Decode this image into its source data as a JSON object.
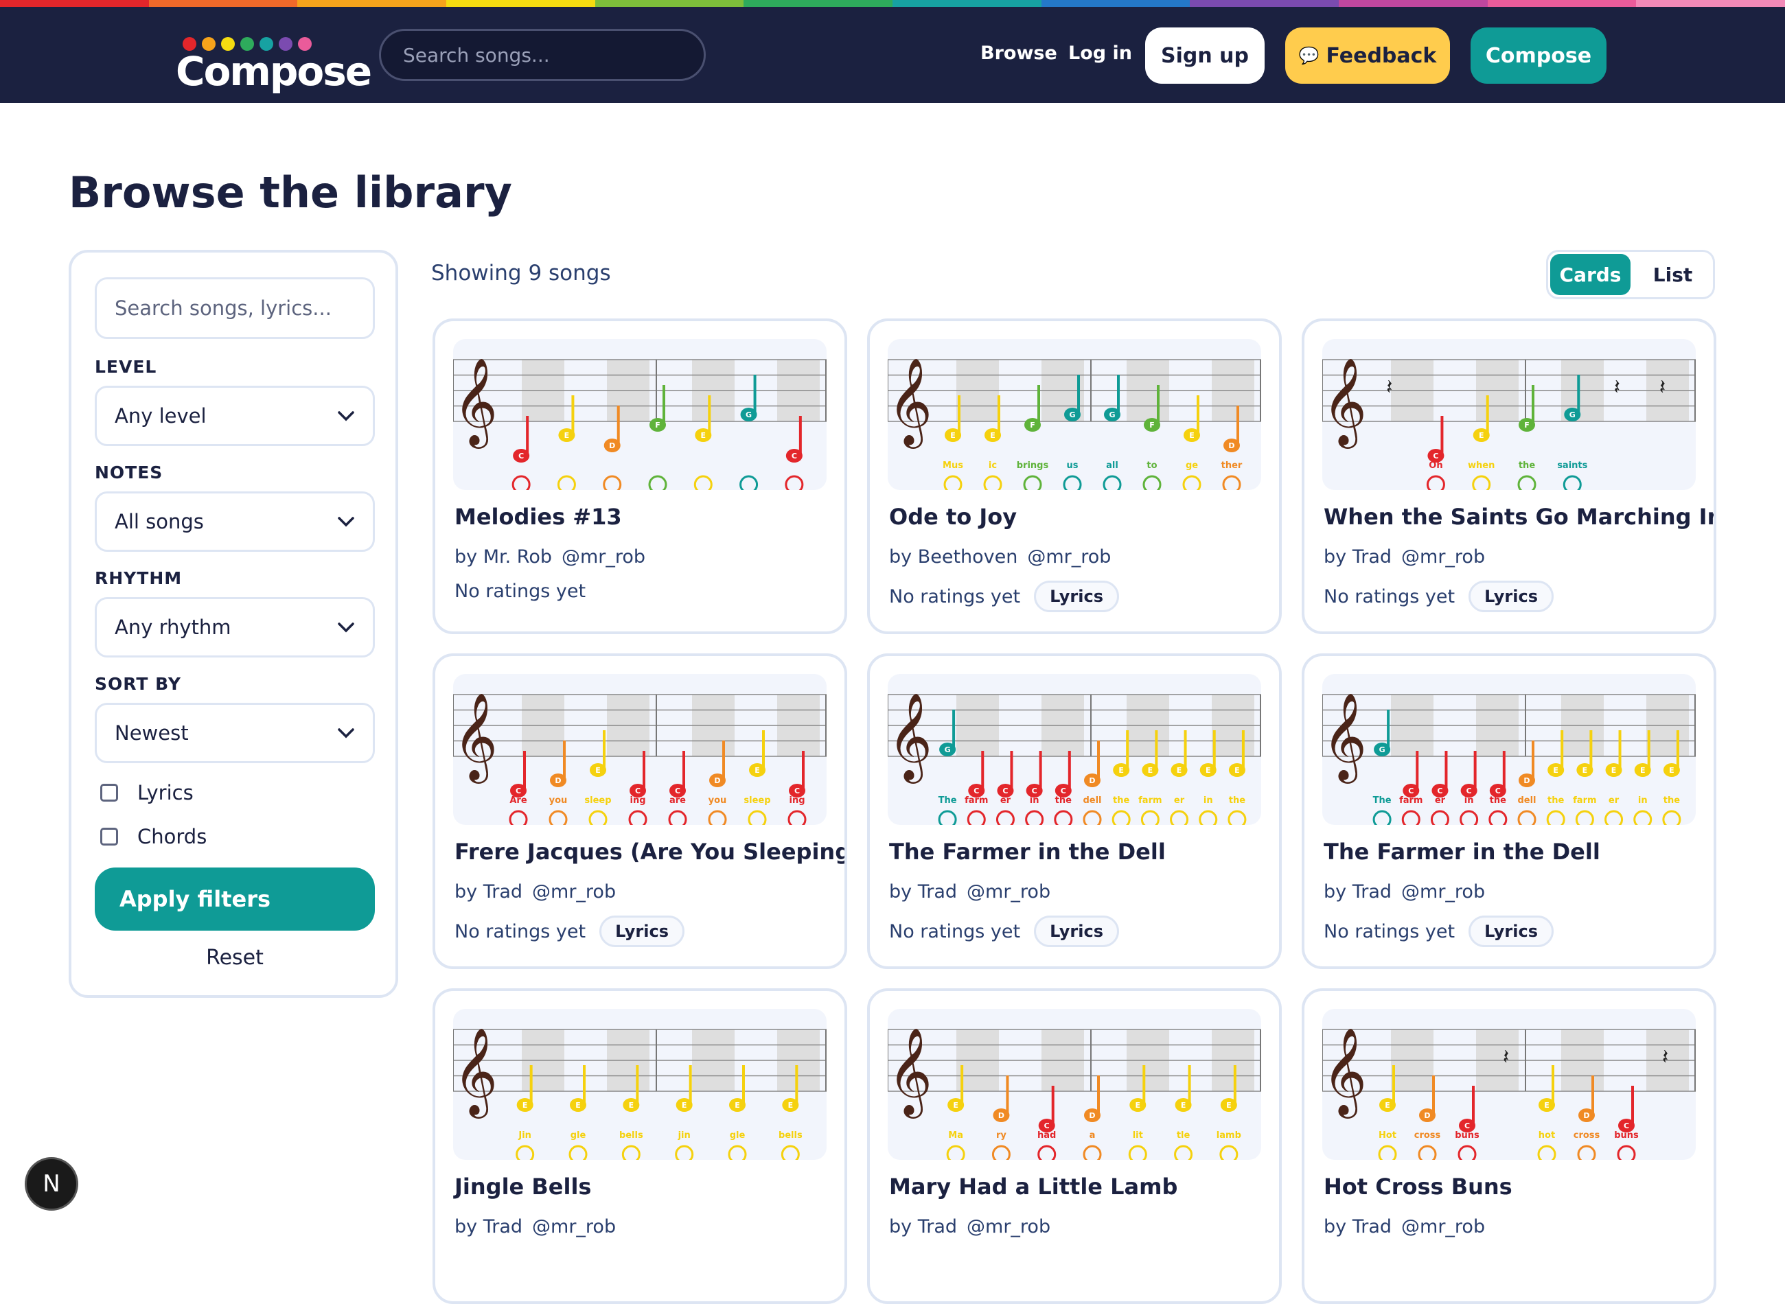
{
  "rainbow": [
    "#e3262b",
    "#f0692a",
    "#f6a31b",
    "#f5dc11",
    "#7dbf3a",
    "#2eab5c",
    "#17a2a2",
    "#2478c8",
    "#7b4bb0",
    "#c0479f",
    "#ea5b9a",
    "#f28ab8"
  ],
  "header": {
    "logo_text": "Compose",
    "search_placeholder": "Search songs...",
    "nav": {
      "browse": "Browse",
      "login": "Log in"
    },
    "signup_label": "Sign up",
    "feedback_label": "Feedback",
    "compose_label": "Compose"
  },
  "page": {
    "title": "Browse the library"
  },
  "sidebar": {
    "search_placeholder": "Search songs, lyrics...",
    "level_label": "LEVEL",
    "level_value": "Any level",
    "notes_label": "NOTES",
    "notes_value": "All songs",
    "rhythm_label": "RHYTHM",
    "rhythm_value": "Any rhythm",
    "sort_label": "SORT BY",
    "sort_value": "Newest",
    "lyrics_label": "Lyrics",
    "chords_label": "Chords",
    "apply_label": "Apply filters",
    "reset_label": "Reset"
  },
  "results": {
    "showing": "Showing 9 songs",
    "view_cards": "Cards",
    "view_list": "List"
  },
  "colors": {
    "C": "#e3262b",
    "D": "#f08a24",
    "E": "#f5d10e",
    "F": "#5fb33a",
    "G": "#0f9b96",
    "A": "#2f6fc0",
    "B": "#8c4bb0",
    "accent": "#0f9b96",
    "navy": "#1b2140",
    "feedback": "#ffcc4d"
  },
  "songs": [
    {
      "title": "Melodies #13",
      "composer": "by Mr. Rob",
      "user": "@mr_rob",
      "rating": "No ratings yet",
      "badge": "",
      "notes": [
        "C",
        "E",
        "D",
        "F",
        "E",
        "G",
        "C"
      ],
      "rests": [
        7
      ],
      "lyrics": []
    },
    {
      "title": "Ode to Joy",
      "composer": "by Beethoven",
      "user": "@mr_rob",
      "rating": "No ratings yet",
      "badge": "Lyrics",
      "notes": [
        "E",
        "E",
        "F",
        "G",
        "G",
        "F",
        "E",
        "D"
      ],
      "rests": [],
      "lyrics": [
        "Mus",
        "ic",
        "brings",
        "us",
        "all",
        "to",
        "ge",
        "ther"
      ]
    },
    {
      "title": "When the Saints Go Marching In",
      "composer": "by Trad",
      "user": "@mr_rob",
      "rating": "No ratings yet",
      "badge": "Lyrics",
      "notes": [
        "-",
        "C",
        "E",
        "F",
        "G",
        "-",
        "-"
      ],
      "rests": [
        0,
        5,
        6
      ],
      "lyrics": [
        "",
        "Oh",
        "when",
        "the",
        "saints",
        "",
        ""
      ]
    },
    {
      "title": "Frere Jacques (Are You Sleeping?)",
      "composer": "by Trad",
      "user": "@mr_rob",
      "rating": "No ratings yet",
      "badge": "Lyrics",
      "notes": [
        "C",
        "D",
        "E",
        "C",
        "C",
        "D",
        "E",
        "C"
      ],
      "rests": [],
      "lyrics": [
        "Are",
        "you",
        "sleep",
        "ing",
        "are",
        "you",
        "sleep",
        "ing"
      ]
    },
    {
      "title": "The Farmer in the Dell",
      "composer": "by Trad",
      "user": "@mr_rob",
      "rating": "No ratings yet",
      "badge": "Lyrics",
      "notes": [
        "G",
        "C",
        "C",
        "C",
        "C",
        "D",
        "E",
        "E",
        "E",
        "E",
        "E"
      ],
      "rests": [],
      "lyrics": [
        "The",
        "farm",
        "er",
        "in",
        "the",
        "dell",
        "the",
        "farm",
        "er",
        "in",
        "the"
      ]
    },
    {
      "title": "The Farmer in the Dell",
      "composer": "by Trad",
      "user": "@mr_rob",
      "rating": "No ratings yet",
      "badge": "Lyrics",
      "notes": [
        "G",
        "C",
        "C",
        "C",
        "C",
        "D",
        "E",
        "E",
        "E",
        "E",
        "E"
      ],
      "rests": [],
      "lyrics": [
        "The",
        "farm",
        "er",
        "in",
        "the",
        "dell",
        "the",
        "farm",
        "er",
        "in",
        "the"
      ]
    },
    {
      "title": "Jingle Bells",
      "composer": "by Trad",
      "user": "@mr_rob",
      "rating": "",
      "badge": "",
      "notes": [
        "E",
        "E",
        "E",
        "E",
        "E",
        "E"
      ],
      "rests": [],
      "lyrics": [
        "Jin",
        "gle",
        "bells",
        "jin",
        "gle",
        "bells"
      ]
    },
    {
      "title": "Mary Had a Little Lamb",
      "composer": "by Trad",
      "user": "@mr_rob",
      "rating": "",
      "badge": "",
      "notes": [
        "E",
        "D",
        "C",
        "D",
        "E",
        "E",
        "E"
      ],
      "rests": [],
      "lyrics": [
        "Ma",
        "ry",
        "had",
        "a",
        "lit",
        "tle",
        "lamb"
      ]
    },
    {
      "title": "Hot Cross Buns",
      "composer": "by Trad",
      "user": "@mr_rob",
      "rating": "",
      "badge": "",
      "notes": [
        "E",
        "D",
        "C",
        "-",
        "E",
        "D",
        "C",
        "-"
      ],
      "rests": [
        3,
        7
      ],
      "lyrics": [
        "Hot",
        "cross",
        "buns",
        "",
        "hot",
        "cross",
        "buns",
        ""
      ]
    }
  ]
}
